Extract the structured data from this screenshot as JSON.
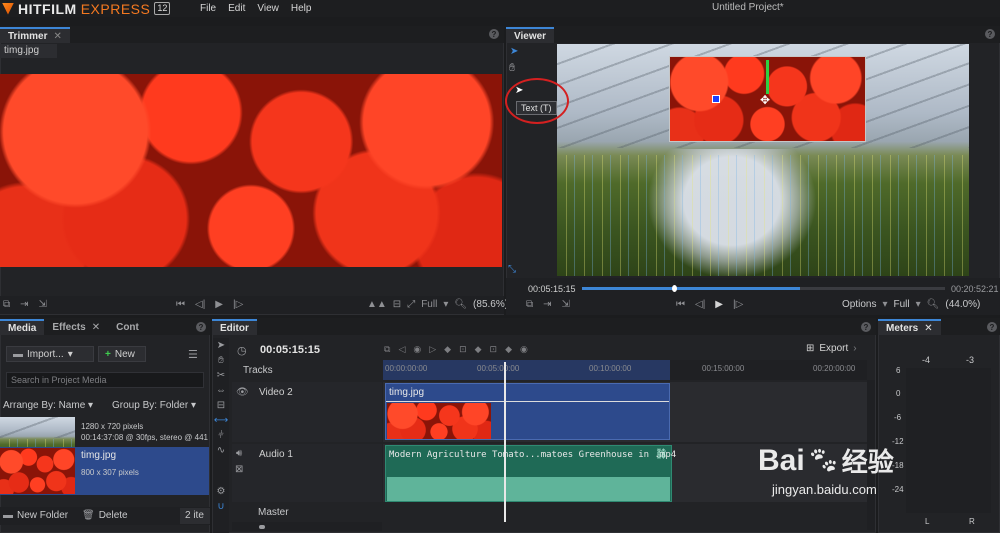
{
  "app": {
    "brand_main": "HITFILM",
    "brand_sub": "EXPRESS",
    "brand_version": "12",
    "menu": [
      "File",
      "Edit",
      "View",
      "Help"
    ],
    "project_title": "Untitled Project*"
  },
  "trimmer": {
    "tab": "Trimmer",
    "file_label": "timg.jpg",
    "quality": "Full",
    "zoom": "(85.6%)"
  },
  "viewer": {
    "tab": "Viewer",
    "tooltip": "Text (T)",
    "timecode_current": "00:05:15:15",
    "timecode_end": "00:20:52:21",
    "options_label": "Options",
    "quality": "Full",
    "zoom": "(44.0%)"
  },
  "media": {
    "tabs": [
      "Media",
      "Effects",
      "Cont"
    ],
    "import_label": "Import...",
    "new_label": "New",
    "search_placeholder": "Search in Project Media",
    "arrange_label": "Arrange By: Name",
    "group_label": "Group By: Folder",
    "items": [
      {
        "name": "",
        "info1": "1280 x 720 pixels",
        "info2": "00:14:37:08 @ 30fps, stereo @ 441"
      },
      {
        "name": "timg.jpg",
        "info1": "800 x 307 pixels",
        "info2": ""
      }
    ],
    "new_folder_label": "New Folder",
    "delete_label": "Delete",
    "count_label": "2 ite"
  },
  "editor": {
    "tab": "Editor",
    "timecode": "00:05:15:15",
    "export_label": "Export",
    "tracks_label": "Tracks",
    "ruler": [
      "00:00:00:00",
      "00:05:00:00",
      "00:10:00:00",
      "00:15:00:00",
      "00:20:00:00"
    ],
    "video_track": "Video 2",
    "video_clip": "timg.jpg",
    "audio_track": "Audio 1",
    "audio_clip": "Modern Agriculture Tomato...matoes Greenhouse in .mp4",
    "master_label": "Master"
  },
  "meters": {
    "tab": "Meters",
    "top_labels": [
      "-4",
      "-3"
    ],
    "scale": [
      "6",
      "0",
      "-6",
      "-12",
      "-18",
      "-24"
    ],
    "channels": [
      "L",
      "R"
    ]
  },
  "watermark": {
    "brand": "Bai",
    "brand2": "经验",
    "url": "jingyan.baidu.com"
  },
  "colors": {
    "accent": "#3d86d6",
    "video_clip": "#2d4a8c",
    "audio_clip": "#1f6a56",
    "brand_orange": "#f47920",
    "annotation": "#d42020"
  }
}
